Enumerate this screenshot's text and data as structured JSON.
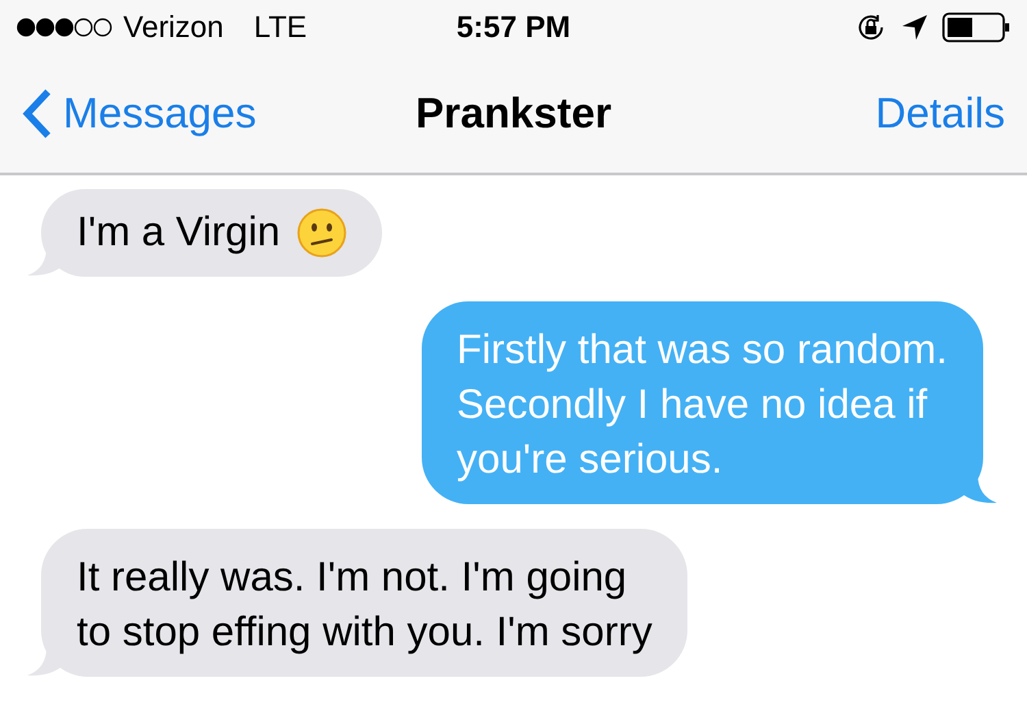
{
  "status_bar": {
    "carrier": "Verizon",
    "network": "LTE",
    "time": "5:57 PM"
  },
  "nav_bar": {
    "back": "Messages",
    "title": "Prankster",
    "action": "Details"
  },
  "messages": [
    {
      "kind": "incoming",
      "lines": [
        "I'm a Virgin"
      ],
      "emoji": true
    },
    {
      "kind": "outgoing",
      "lines": [
        "Firstly that was so random.",
        "Secondly I have no idea if",
        "you're serious."
      ],
      "emoji": false
    },
    {
      "kind": "incoming",
      "lines": [
        "It really was. I'm not. I'm going",
        "to stop effing with you. I'm sorry"
      ],
      "emoji": false
    }
  ]
}
